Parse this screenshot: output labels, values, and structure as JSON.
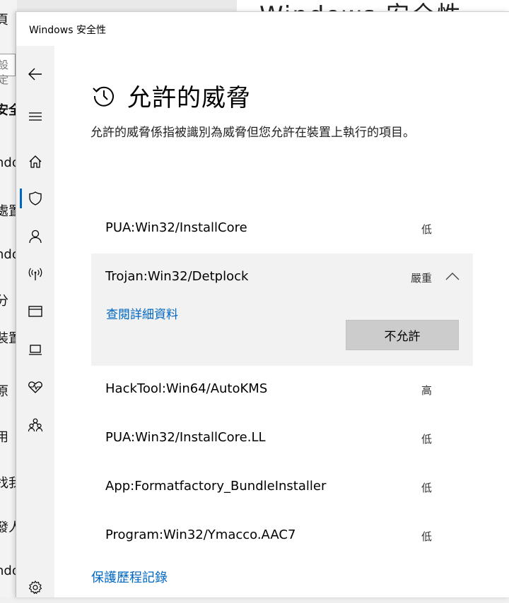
{
  "background": {
    "window_title": "Windows 安全性",
    "left_items": [
      "頁",
      "設定",
      "安全",
      "ndo",
      "處置",
      "ndo",
      "分",
      "裝置",
      "原",
      "用",
      "找我",
      "發人",
      "ndo"
    ]
  },
  "window": {
    "title": "Windows 安全性"
  },
  "nav": [
    {
      "icon": "back-arrow-icon"
    },
    {
      "icon": "hamburger-menu-icon"
    },
    {
      "icon": "home-icon"
    },
    {
      "icon": "shield-icon",
      "selected": true
    },
    {
      "icon": "person-icon"
    },
    {
      "icon": "wireless-antenna-icon"
    },
    {
      "icon": "browser-window-icon"
    },
    {
      "icon": "laptop-icon"
    },
    {
      "icon": "heart-pulse-icon"
    },
    {
      "icon": "family-icon"
    },
    {
      "icon": "gear-icon"
    }
  ],
  "page": {
    "title": "允許的威脅",
    "description": "允許的威脅係指被識別為威脅但您允許在裝置上執行的項目。"
  },
  "threats": [
    {
      "name": "PUA:Win32/InstallCore",
      "severity": "低"
    },
    {
      "name": "Trojan:Win32/Detplock",
      "severity": "嚴重",
      "expanded": true,
      "details_link": "查閱詳細資料",
      "action_button": "不允許"
    },
    {
      "name": "HackTool:Win64/AutoKMS",
      "severity": "高"
    },
    {
      "name": "PUA:Win32/InstallCore.LL",
      "severity": "低"
    },
    {
      "name": "App:Formatfactory_BundleInstaller",
      "severity": "低"
    },
    {
      "name": "Program:Win32/Ymacco.AAC7",
      "severity": "低"
    }
  ],
  "footer": {
    "history_link": "保護歷程記錄"
  },
  "colors": {
    "accent": "#0067c0",
    "nav_bg": "#f2f2f2",
    "expanded_bg": "#f2f2f2",
    "button_bg": "#cccccc"
  }
}
